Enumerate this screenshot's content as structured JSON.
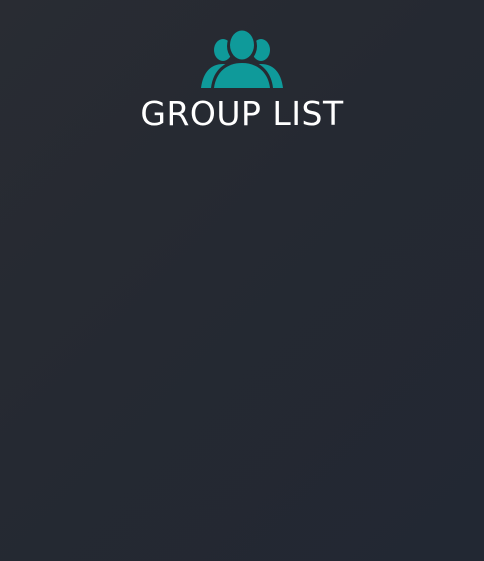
{
  "header": {
    "icon": "group-users-icon",
    "title": "GROUP LIST"
  },
  "colors": {
    "background": "#262a32",
    "icon": "#0f9a9a",
    "title": "#ffffff"
  },
  "groups": []
}
